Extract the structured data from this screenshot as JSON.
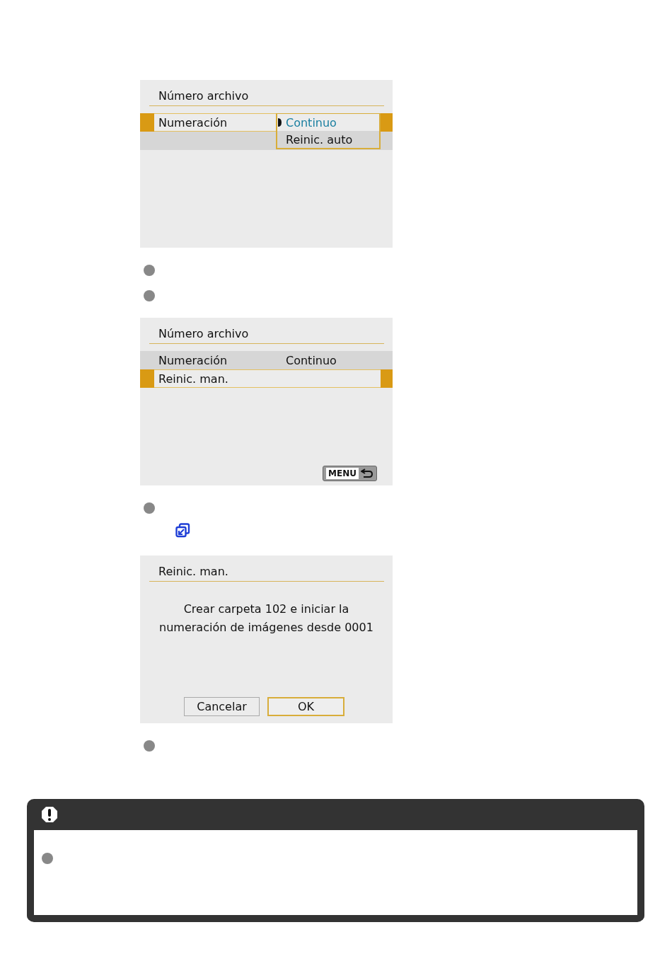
{
  "steps": [
    {
      "screen": {
        "kind": "menu",
        "title": "Número archivo",
        "rows": [
          {
            "label": "Numeración",
            "selected": true
          },
          {
            "selected": false
          }
        ],
        "dropdown": {
          "options": [
            {
              "label": "Continuo",
              "selected": true
            },
            {
              "label": "Reinic. auto",
              "selected": false
            }
          ]
        }
      },
      "items": [
        {
          "kind": "bullet"
        },
        {
          "kind": "bullet"
        }
      ]
    },
    {
      "screen": {
        "kind": "menu",
        "title": "Número archivo",
        "rows": [
          {
            "label": "Numeración",
            "value": "Continuo",
            "selected": false
          },
          {
            "label": "Reinic. man.",
            "selected": true
          }
        ],
        "back_button": "MENU"
      },
      "items": [
        {
          "kind": "bullet"
        },
        {
          "kind": "link"
        }
      ]
    },
    {
      "screen": {
        "kind": "dialog",
        "title": "Reinic. man.",
        "message": "Crear carpeta 102 e iniciar la\nnumeración de imágenes desde 0001",
        "buttons": [
          {
            "label": "Cancelar",
            "selected": false
          },
          {
            "label": "OK",
            "selected": true
          }
        ]
      },
      "items": [
        {
          "kind": "bullet"
        }
      ]
    }
  ],
  "caution": {
    "items": [
      {
        "kind": "bullet"
      }
    ]
  }
}
